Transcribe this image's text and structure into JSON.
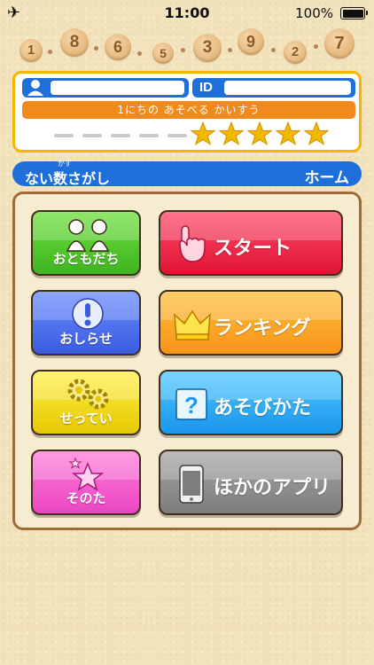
{
  "status_bar": {
    "time": "11:00",
    "battery": "100%"
  },
  "number_row": [
    "1",
    "8",
    "6",
    "5",
    "3",
    "9",
    "2",
    "7"
  ],
  "profile": {
    "id_label": "ID",
    "name_value": "",
    "id_value": ""
  },
  "daily_plays": {
    "label": "1にちの あそべる かいすう",
    "remaining_stars": 5,
    "used": 5,
    "max": 10
  },
  "header": {
    "title": "ない数さがし",
    "ruby": "かず",
    "home": "ホーム"
  },
  "menu": {
    "friends": "おともだち",
    "start": "スタート",
    "notice": "おしらせ",
    "ranking": "ランキング",
    "settings": "せってい",
    "howto": "あそびかた",
    "other": "そのた",
    "other_apps": "ほかのアプリ"
  },
  "colors": {
    "accent_blue": "#1e6fd9",
    "panel_border": "#f5b600",
    "star": "#f5b800"
  }
}
